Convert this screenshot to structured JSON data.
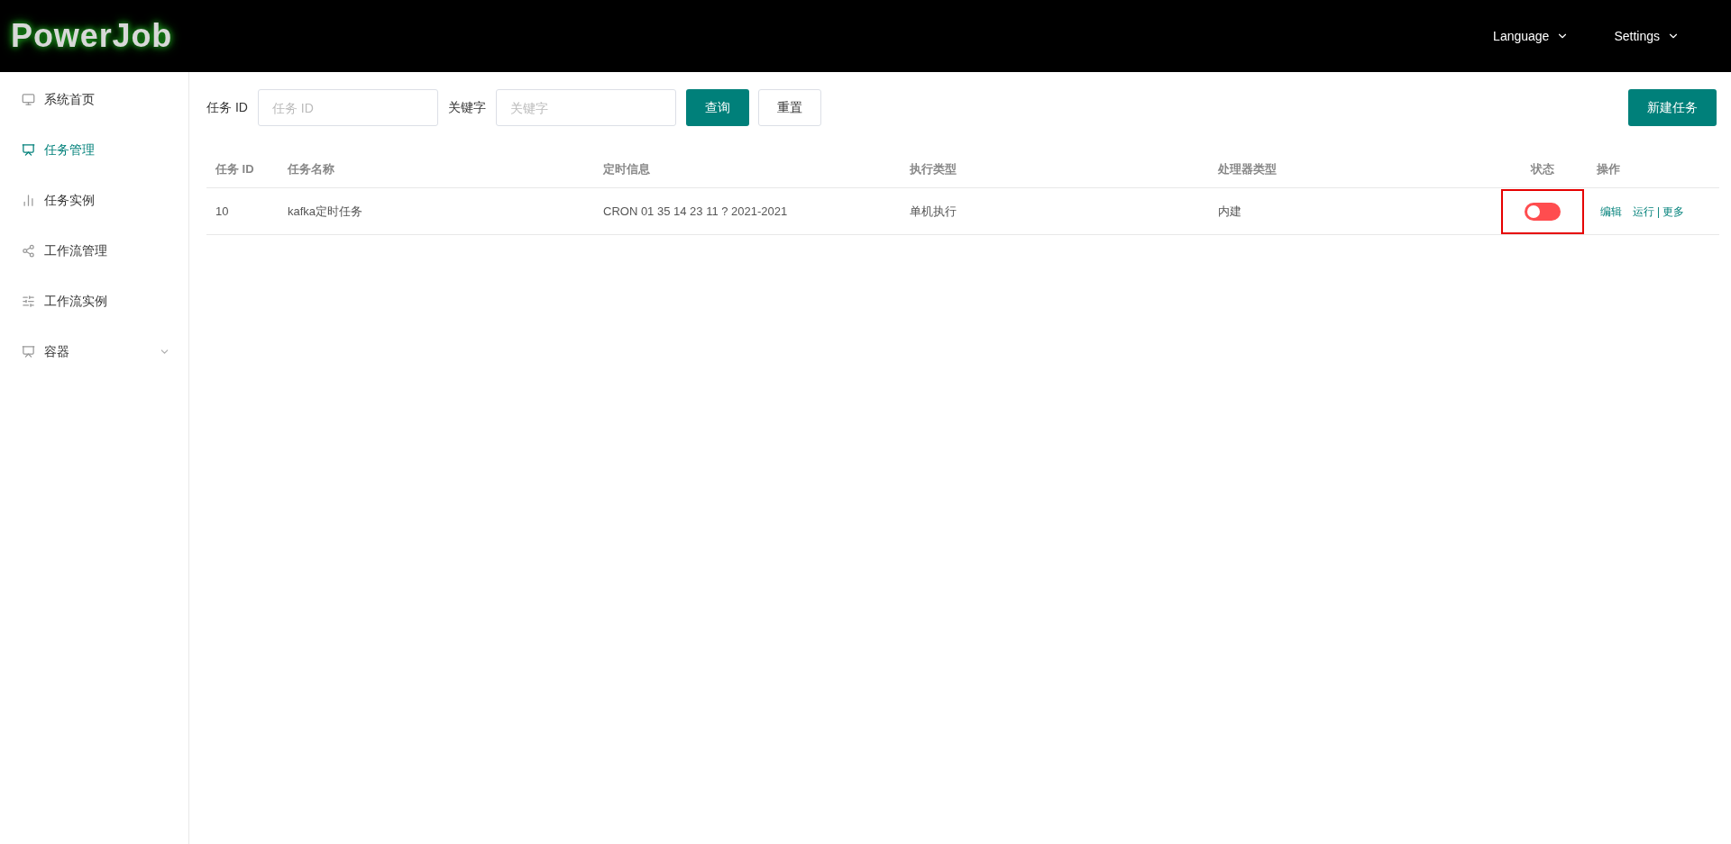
{
  "header": {
    "logo": "PowerJob",
    "menus": [
      {
        "label": "Language"
      },
      {
        "label": "Settings"
      }
    ]
  },
  "sidebar": {
    "items": [
      {
        "label": "系统首页",
        "selected": false
      },
      {
        "label": "任务管理",
        "selected": true
      },
      {
        "label": "任务实例",
        "selected": false
      },
      {
        "label": "工作流管理",
        "selected": false
      },
      {
        "label": "工作流实例",
        "selected": false
      },
      {
        "label": "容器",
        "selected": false,
        "expanded": false
      }
    ]
  },
  "filters": {
    "fields": [
      {
        "label": "任务 ID",
        "placeholder": "任务 ID"
      },
      {
        "label": "关键字",
        "placeholder": "关键字"
      }
    ],
    "search_button": "查询",
    "reset_button": "重置",
    "new_button": "新建任务"
  },
  "table": {
    "columns": [
      "任务 ID",
      "任务名称",
      "定时信息",
      "执行类型",
      "处理器类型",
      "状态",
      "操作"
    ],
    "rows": [
      {
        "id": "10",
        "name": "kafka定时任务",
        "schedule": "CRON 01 35 14 23 11 ? 2021-2021",
        "exec_type": "单机执行",
        "processor_type": "内建",
        "enabled": false,
        "highlighted": true,
        "actions": [
          "编辑",
          "运行",
          "更多"
        ],
        "action_separator": "|"
      }
    ]
  }
}
